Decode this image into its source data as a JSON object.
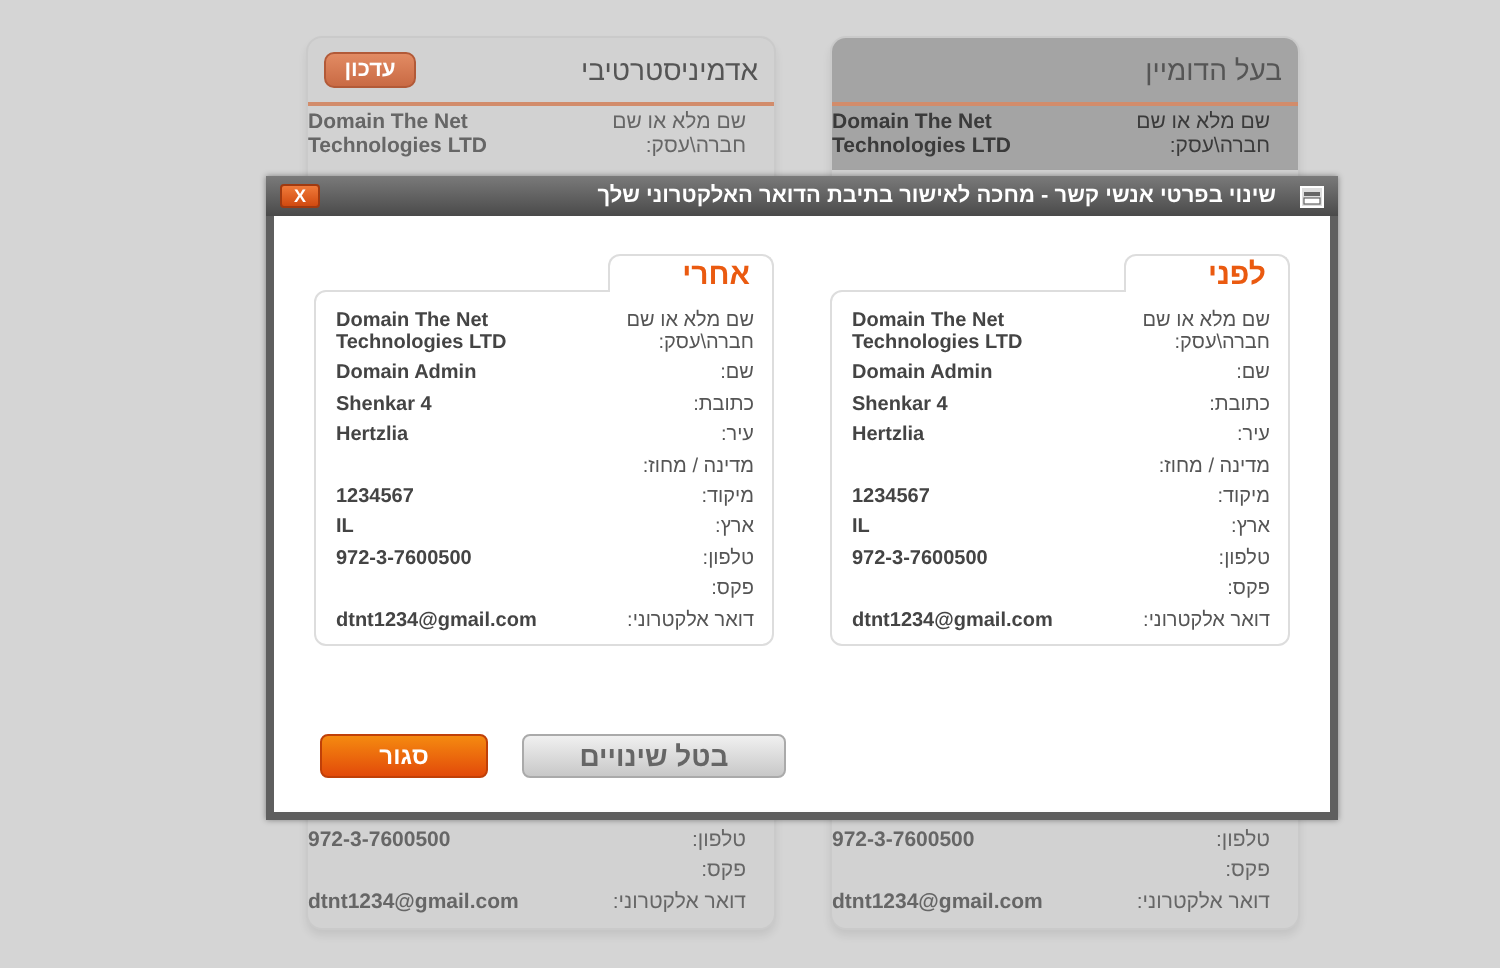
{
  "background_cards": [
    {
      "title": "בעל הדומיין",
      "highlighted": true,
      "rows_top": [
        {
          "label": "שם מלא או שם חברה\\עסק:",
          "value": "Domain The Net Technologies LTD"
        }
      ],
      "rows_bottom": [
        {
          "label": "טלפון:",
          "value": "972-3-7600500"
        },
        {
          "label": "פקס:"
        },
        {
          "label": "דואר אלקטרוני:",
          "value": "dtnt1234@gmail.com"
        }
      ]
    },
    {
      "title": "אדמיניסטרטיבי",
      "highlighted": false,
      "button": "עדכון",
      "rows_top": [
        {
          "label": "שם מלא או שם חברה\\עסק:",
          "value": "Domain The Net Technologies LTD"
        }
      ],
      "rows_bottom": [
        {
          "label": "טלפון:",
          "value": "972-3-7600500"
        },
        {
          "label": "פקס:"
        },
        {
          "label": "דואר אלקטרוני:",
          "value": "dtnt1234@gmail.com"
        }
      ]
    }
  ],
  "dialog": {
    "title": "שינוי בפרטי אנשי קשר - מחכה לאישור בתיבת הדואר האלקטרוני שלך",
    "close_label": "X",
    "panels": [
      {
        "tab": "לפני",
        "rows": [
          {
            "label": "שם מלא או שם חברה\\עסק:",
            "value": "Domain The Net Technologies LTD"
          },
          {
            "label": "שם:",
            "value": "Domain Admin"
          },
          {
            "label": "כתובת:",
            "value": "Shenkar 4"
          },
          {
            "label": "עיר:",
            "value": "Hertzlia"
          },
          {
            "label": "מדינה / מחוז:"
          },
          {
            "label": "מיקוד:",
            "value": "1234567"
          },
          {
            "label": "ארץ:",
            "value": "IL"
          },
          {
            "label": "טלפון:",
            "value": "972-3-7600500"
          },
          {
            "label": "פקס:"
          },
          {
            "label": "דואר אלקטרוני:",
            "value": "dtnt1234@gmail.com"
          }
        ]
      },
      {
        "tab": "אחרי",
        "rows": [
          {
            "label": "שם מלא או שם חברה\\עסק:",
            "value": "Domain The Net Technologies LTD"
          },
          {
            "label": "שם:",
            "value": "Domain Admin"
          },
          {
            "label": "כתובת:",
            "value": "Shenkar 4"
          },
          {
            "label": "עיר:",
            "value": "Hertzlia"
          },
          {
            "label": "מדינה / מחוז:"
          },
          {
            "label": "מיקוד:",
            "value": "1234567"
          },
          {
            "label": "ארץ:",
            "value": "IL"
          },
          {
            "label": "טלפון:",
            "value": "972-3-7600500"
          },
          {
            "label": "פקס:"
          },
          {
            "label": "דואר אלקטרוני:",
            "value": "dtnt1234@gmail.com"
          }
        ]
      }
    ],
    "buttons": [
      {
        "label": "בטל שינויים",
        "kind": "secondary"
      },
      {
        "label": "סגור",
        "kind": "primary"
      }
    ]
  }
}
